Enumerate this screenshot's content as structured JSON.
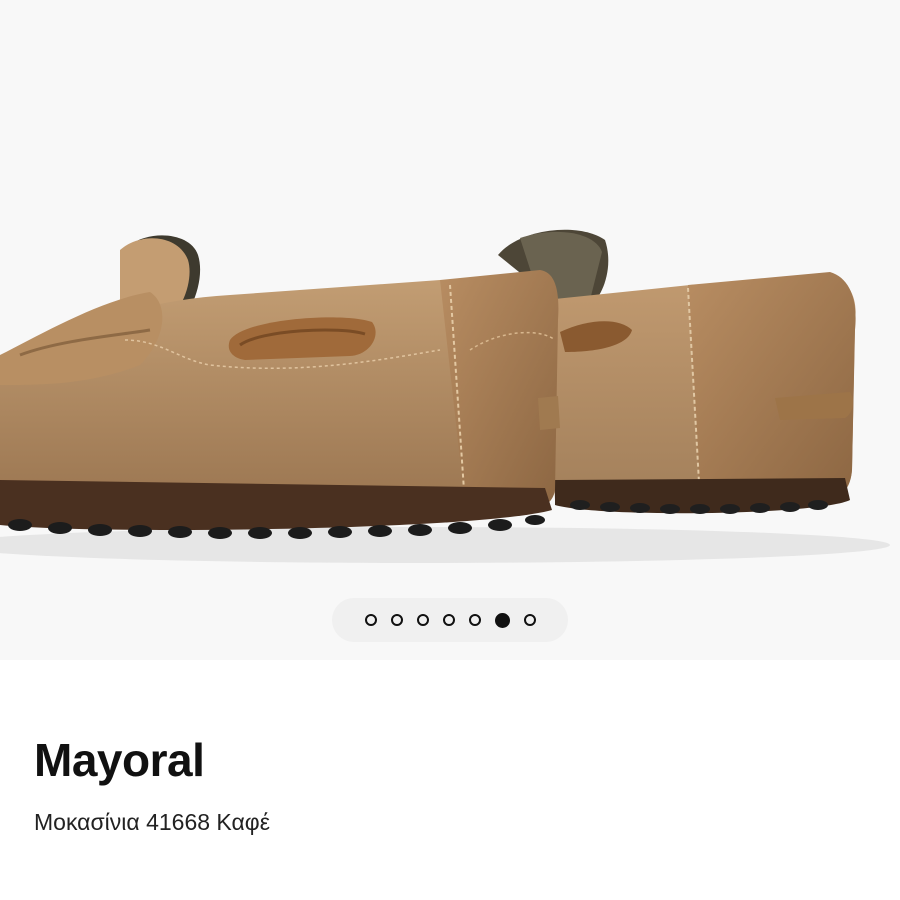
{
  "gallery": {
    "image_alt": "Mayoral Μοκασίνια 41668 Καφέ",
    "slide_count": 7,
    "active_slide": 6
  },
  "product": {
    "brand": "Mayoral",
    "name": "Μοκασίνια 41668 Καφέ"
  },
  "colors": {
    "suede": "#b08a62",
    "leather": "#a07850",
    "sole": "#5a3a26",
    "accent": "#111111"
  }
}
